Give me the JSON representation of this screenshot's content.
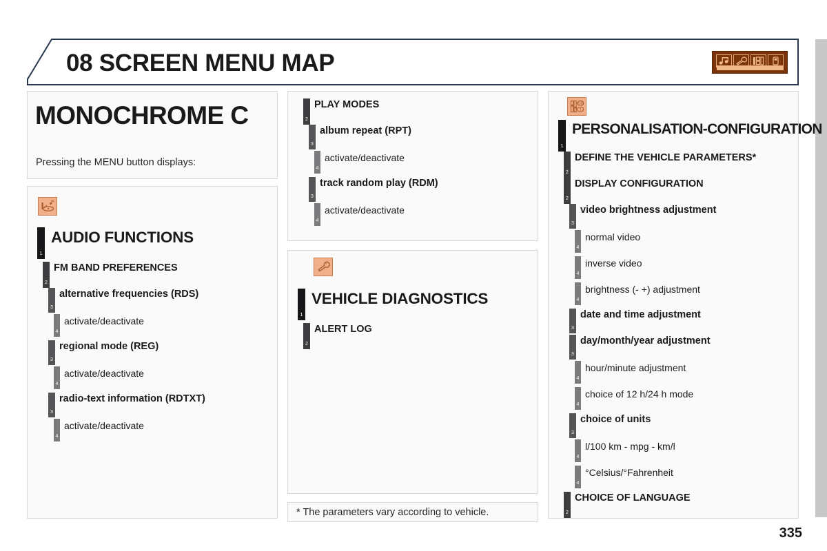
{
  "header": {
    "title": "08 SCREEN MENU MAP",
    "icon_name": "menu-pictogram-strip",
    "accent_color": "#7a3208",
    "icon_cells": [
      "♪",
      "⚒",
      "‖",
      "□"
    ]
  },
  "monochrome": {
    "title": "MONOCHROME C",
    "subtitle": "Pressing the MENU button displays:"
  },
  "audio": {
    "icon_name": "audio-icon",
    "rows": [
      {
        "level": 1,
        "label": "AUDIO FUNCTIONS"
      },
      {
        "level": 2,
        "label": "FM BAND PREFERENCES"
      },
      {
        "level": 3,
        "label": "alternative frequencies (RDS)"
      },
      {
        "level": 4,
        "label": "activate/deactivate"
      },
      {
        "level": 3,
        "label": "regional mode (REG)"
      },
      {
        "level": 4,
        "label": "activate/deactivate"
      },
      {
        "level": 3,
        "label": "radio-text information (RDTXT)"
      },
      {
        "level": 4,
        "label": "activate/deactivate"
      }
    ]
  },
  "play_modes": {
    "rows": [
      {
        "level": 2,
        "label": "PLAY MODES"
      },
      {
        "level": 3,
        "label": "album repeat (RPT)"
      },
      {
        "level": 4,
        "label": "activate/deactivate"
      },
      {
        "level": 3,
        "label": "track random play (RDM)"
      },
      {
        "level": 4,
        "label": "activate/deactivate"
      }
    ]
  },
  "diagnostics": {
    "icon_name": "wrench-icon",
    "rows": [
      {
        "level": 1,
        "label": "VEHICLE DIAGNOSTICS"
      },
      {
        "level": 2,
        "label": "ALERT LOG"
      }
    ]
  },
  "personalisation": {
    "icon_name": "settings-sliders-icon",
    "rows": [
      {
        "level": 1,
        "label": "PERSONALISATION-CONFIGURATION"
      },
      {
        "level": 2,
        "label": "DEFINE THE VEHICLE PARAMETERS*"
      },
      {
        "level": 2,
        "label": "DISPLAY CONFIGURATION"
      },
      {
        "level": 3,
        "label": "video brightness adjustment"
      },
      {
        "level": 4,
        "label": "normal video"
      },
      {
        "level": 4,
        "label": "inverse video"
      },
      {
        "level": 4,
        "label": "brightness (- +) adjustment"
      },
      {
        "level": 3,
        "label": "date and time adjustment"
      },
      {
        "level": 3,
        "label": "day/month/year adjustment"
      },
      {
        "level": 4,
        "label": "hour/minute adjustment"
      },
      {
        "level": 4,
        "label": "choice of 12 h/24 h mode"
      },
      {
        "level": 3,
        "label": "choice of units"
      },
      {
        "level": 4,
        "label": "l/100 km - mpg - km/l"
      },
      {
        "level": 4,
        "label": "°Celsius/°Fahrenheit"
      },
      {
        "level": 2,
        "label": "CHOICE OF LANGUAGE"
      }
    ]
  },
  "footnote": {
    "text": "* The parameters vary according to vehicle."
  },
  "page_number": "335"
}
